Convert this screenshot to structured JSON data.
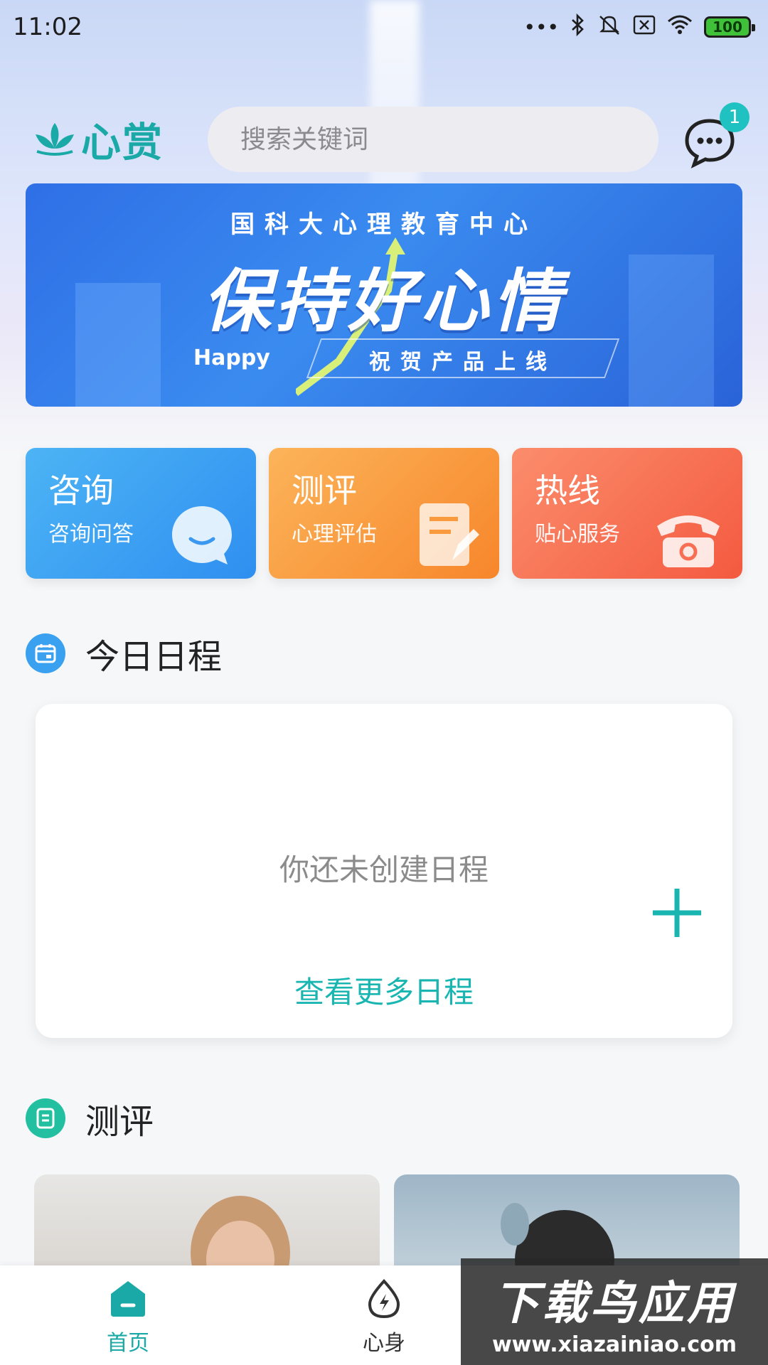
{
  "status_bar": {
    "time": "11:02",
    "battery": "100"
  },
  "header": {
    "logo_text": "心赏",
    "search_placeholder": "搜索关键词",
    "message_badge": "1"
  },
  "banner": {
    "subtitle": "国科大心理教育中心",
    "title": "保持好心情",
    "happy": "Happy",
    "tagline": "祝贺产品上线"
  },
  "quick_cards": [
    {
      "title": "咨询",
      "subtitle": "咨询问答",
      "icon": "chat-bubble-icon"
    },
    {
      "title": "测评",
      "subtitle": "心理评估",
      "icon": "document-edit-icon"
    },
    {
      "title": "热线",
      "subtitle": "贴心服务",
      "icon": "telephone-icon"
    }
  ],
  "schedule": {
    "section_title": "今日日程",
    "empty_text": "你还未创建日程",
    "more_link": "查看更多日程"
  },
  "assessment": {
    "section_title": "测评"
  },
  "bottom_nav": [
    {
      "label": "首页",
      "icon": "home-icon",
      "active": true
    },
    {
      "label": "心身",
      "icon": "energy-drop-icon",
      "active": false
    }
  ],
  "watermark": {
    "title": "下载鸟应用",
    "url": "www.xiazainiao.com"
  },
  "colors": {
    "brand": "#1aa9a6",
    "consult": "#3a9ff3",
    "assess": "#f99a3e",
    "hotline": "#f76e52"
  }
}
